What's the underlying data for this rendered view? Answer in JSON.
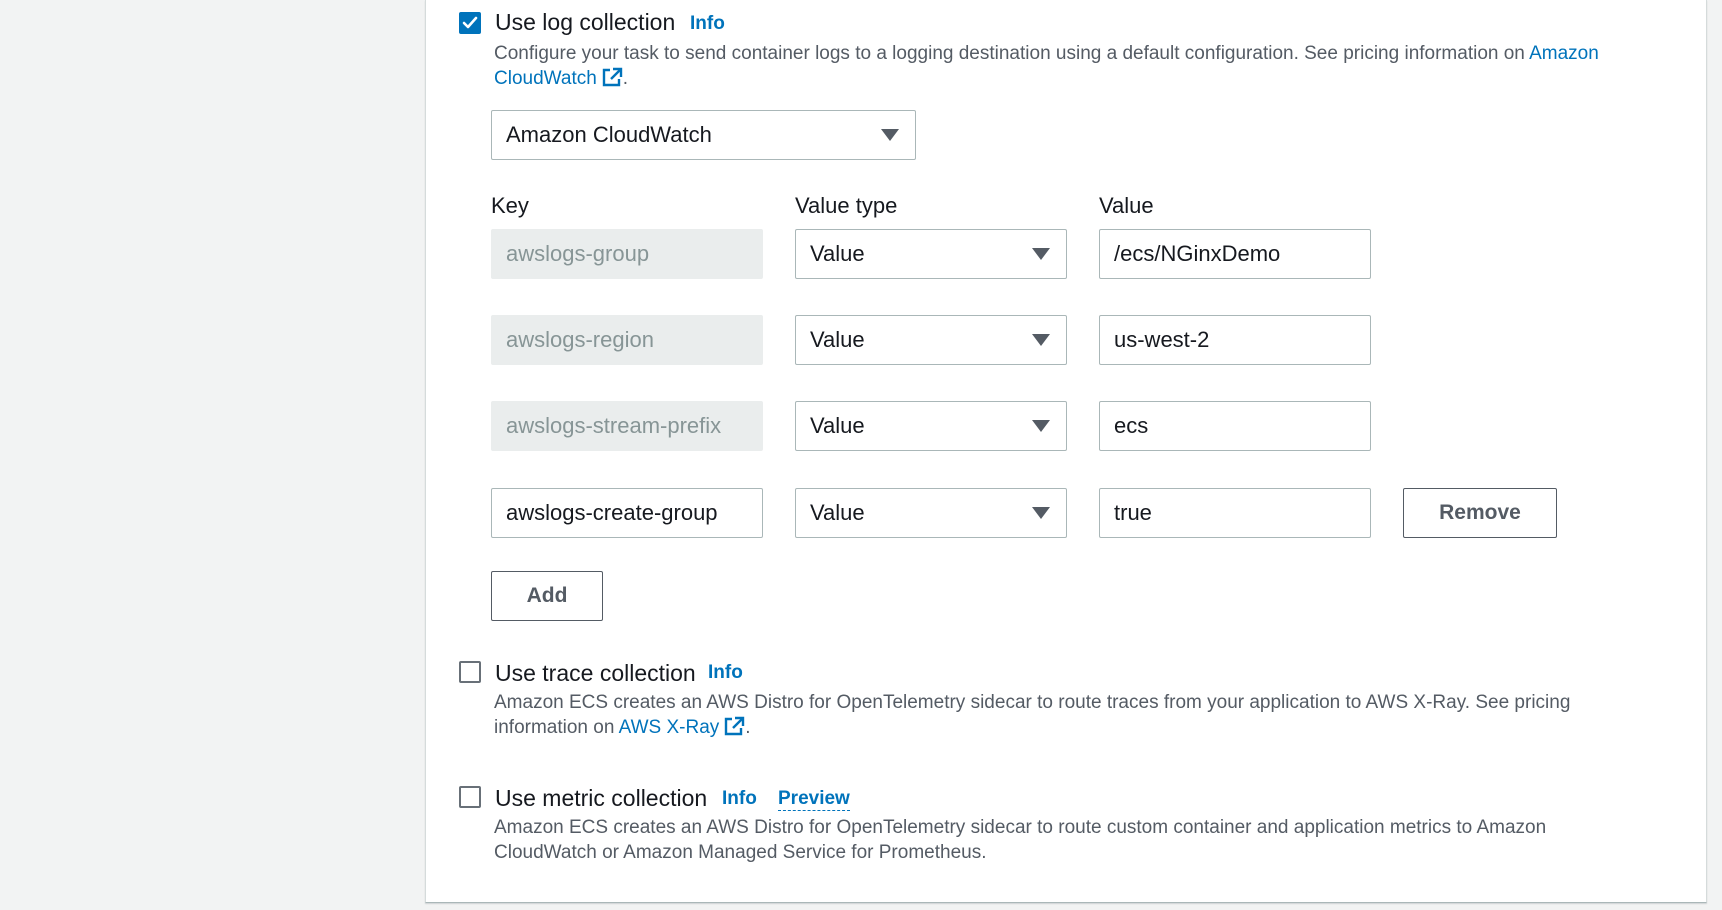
{
  "log_collection": {
    "label": "Use log collection",
    "checked": true,
    "info": "Info",
    "description": "Configure your task to send container logs to a logging destination using a default configuration. See pricing information on",
    "link_line1": "Amazon",
    "link_line2": "CloudWatch",
    "link_suffix": ".",
    "destination": "Amazon CloudWatch",
    "columns": {
      "key": "Key",
      "value_type": "Value type",
      "value": "Value"
    },
    "rows": [
      {
        "key": "awslogs-group",
        "value_type": "Value",
        "value": "/ecs/NGinxDemo",
        "editable_key": false
      },
      {
        "key": "awslogs-region",
        "value_type": "Value",
        "value": "us-west-2",
        "editable_key": false
      },
      {
        "key": "awslogs-stream-prefix",
        "value_type": "Value",
        "value": "ecs",
        "editable_key": false
      },
      {
        "key": "awslogs-create-group",
        "value_type": "Value",
        "value": "true",
        "editable_key": true
      }
    ],
    "remove_label": "Remove",
    "add_label": "Add"
  },
  "trace_collection": {
    "label": "Use trace collection",
    "checked": false,
    "info": "Info",
    "description_line1": "Amazon ECS creates an AWS Distro for OpenTelemetry sidecar to route traces from your application to AWS X-Ray. See pricing",
    "description_line2": "information on",
    "link": "AWS X-Ray",
    "link_suffix": "."
  },
  "metric_collection": {
    "label": "Use metric collection",
    "checked": false,
    "info": "Info",
    "preview": "Preview",
    "description_line1": "Amazon ECS creates an AWS Distro for OpenTelemetry sidecar to route custom container and application metrics to Amazon",
    "description_line2": "CloudWatch or Amazon Managed Service for Prometheus."
  },
  "colors": {
    "link": "#0073bb",
    "checkbox_checked": "#0073bb",
    "text_primary": "#16191f",
    "text_secondary": "#545b64",
    "disabled_bg": "#eaeded",
    "page_bg": "#f2f3f3"
  },
  "icons": {
    "external_link": "external-link-icon",
    "dropdown": "caret-down-icon",
    "check": "check-icon"
  }
}
